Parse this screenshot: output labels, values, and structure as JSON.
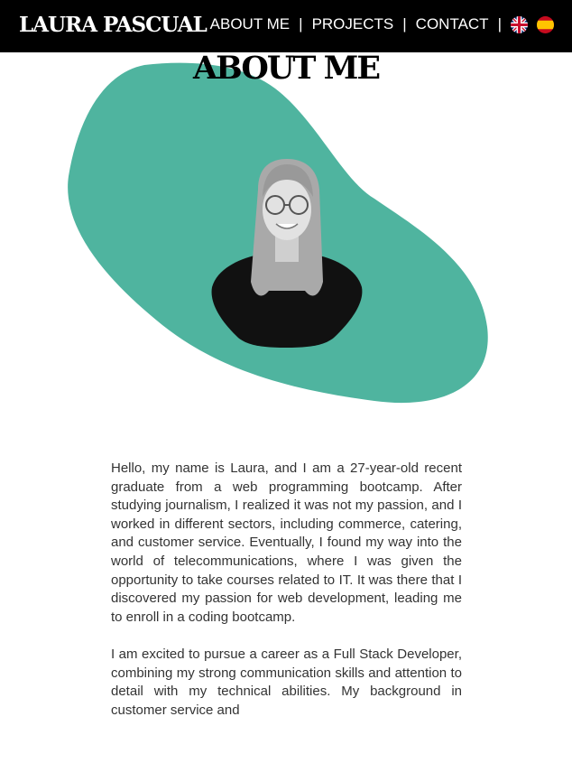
{
  "header": {
    "brand": "LAURA PASCUAL",
    "nav": [
      {
        "label": "ABOUT ME"
      },
      {
        "label": "PROJECTS"
      },
      {
        "label": "CONTACT"
      }
    ],
    "separator": "|",
    "languages": [
      {
        "icon": "uk-flag-icon"
      },
      {
        "icon": "spain-flag-icon"
      }
    ]
  },
  "main": {
    "title": "ABOUT ME",
    "blob_color": "#4fb49f",
    "paragraphs": [
      "Hello, my name is Laura, and I am a 27-year-old recent graduate from a web programming bootcamp. After studying journalism, I realized it was not my passion, and I worked in different sectors, including commerce, catering, and customer service. Eventually, I found my way into the world of telecommunications, where I was given the opportunity to take courses related to IT. It was there that I discovered my passion for web development, leading me to enroll in a coding bootcamp.",
      "I am excited to pursue a career as a Full Stack Developer, combining my strong communication skills and attention to detail with my technical abilities. My background in customer service and"
    ]
  }
}
